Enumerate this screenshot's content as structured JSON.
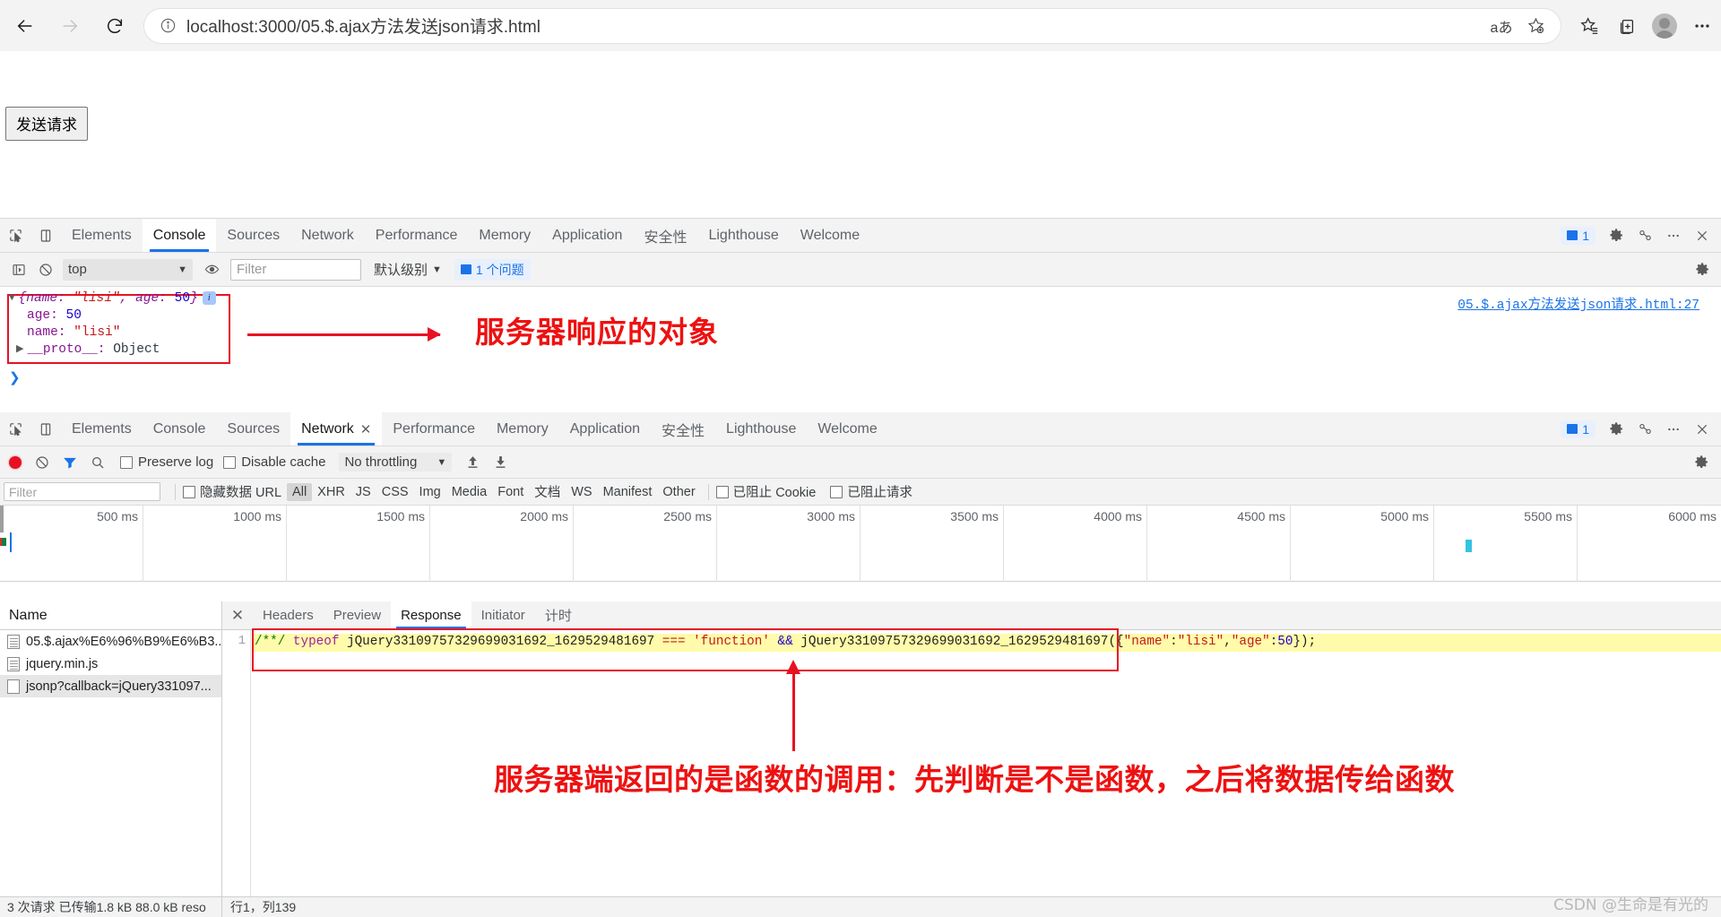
{
  "browser": {
    "back_label": "back-arrow",
    "forward_label": "forward-arrow",
    "reload_label": "reload",
    "url": "localhost:3000/05.$.ajax方法发送json请求.html",
    "read_aloud_label": "aあ",
    "favorite_label": "add-favorite",
    "collections_label": "collections",
    "split_screen_label": "split-screen",
    "profile_label": "profile",
    "settings_label": "..."
  },
  "page": {
    "send_button": "发送请求"
  },
  "console_panel": {
    "tabs": [
      {
        "label": "Elements",
        "active": false
      },
      {
        "label": "Console",
        "active": true
      },
      {
        "label": "Sources",
        "active": false
      },
      {
        "label": "Network",
        "active": false
      },
      {
        "label": "Performance",
        "active": false
      },
      {
        "label": "Memory",
        "active": false
      },
      {
        "label": "Application",
        "active": false
      },
      {
        "label": "安全性",
        "active": false
      },
      {
        "label": "Lighthouse",
        "active": false
      },
      {
        "label": "Welcome",
        "active": false
      }
    ],
    "issues_count": "1",
    "toolbar": {
      "context": "top",
      "filter_placeholder": "Filter",
      "level": "默认级别",
      "issues_pill": "1 个问题"
    },
    "log": {
      "summary_prefix": "{name: ",
      "summary_name": "\"lisi\"",
      "summary_mid": ", age: ",
      "summary_age": "50",
      "summary_suffix": "}",
      "age_key": "age: ",
      "age_value": "50",
      "name_key": "name: ",
      "name_value": "\"lisi\"",
      "proto_key": "__proto__: ",
      "proto_value": "Object"
    },
    "source_link": "05.$.ajax方法发送json请求.html:27",
    "annotation": "服务器响应的对象"
  },
  "network_panel": {
    "tabs": [
      {
        "label": "Elements",
        "active": false,
        "closable": false
      },
      {
        "label": "Console",
        "active": false,
        "closable": false
      },
      {
        "label": "Sources",
        "active": false,
        "closable": false
      },
      {
        "label": "Network",
        "active": true,
        "closable": true
      },
      {
        "label": "Performance",
        "active": false,
        "closable": false
      },
      {
        "label": "Memory",
        "active": false,
        "closable": false
      },
      {
        "label": "Application",
        "active": false,
        "closable": false
      },
      {
        "label": "安全性",
        "active": false,
        "closable": false
      },
      {
        "label": "Lighthouse",
        "active": false,
        "closable": false
      },
      {
        "label": "Welcome",
        "active": false,
        "closable": false
      }
    ],
    "issues_pill": "1",
    "toolbar": {
      "preserve_log": "Preserve log",
      "disable_cache": "Disable cache",
      "throttling": "No throttling"
    },
    "filterbar": {
      "filter_placeholder": "Filter",
      "hide_data_urls": "隐藏数据 URL",
      "types": [
        "All",
        "XHR",
        "JS",
        "CSS",
        "Img",
        "Media",
        "Font",
        "文档",
        "WS",
        "Manifest",
        "Other"
      ],
      "active_type": "All",
      "blocked_cookies": "已阻止 Cookie",
      "blocked_requests": "已阻止请求"
    },
    "timeline_ticks": [
      "500 ms",
      "1000 ms",
      "1500 ms",
      "2000 ms",
      "2500 ms",
      "3000 ms",
      "3500 ms",
      "4000 ms",
      "4500 ms",
      "5000 ms",
      "5500 ms",
      "6000 ms"
    ],
    "name_header": "Name",
    "requests": [
      {
        "name": "05.$.ajax%E6%96%B9%E6%B3...",
        "selected": false,
        "type": "doc"
      },
      {
        "name": "jquery.min.js",
        "selected": false,
        "type": "doc"
      },
      {
        "name": "jsonp?callback=jQuery331097...",
        "selected": true,
        "type": "plain"
      }
    ],
    "detail_tabs": [
      {
        "label": "Headers",
        "active": false
      },
      {
        "label": "Preview",
        "active": false
      },
      {
        "label": "Response",
        "active": true
      },
      {
        "label": "Initiator",
        "active": false
      },
      {
        "label": "计时",
        "active": false
      }
    ],
    "response": {
      "line_number": "1",
      "comment": "/**/",
      "keyword": "typeof",
      "callback1": "jQuery33109757329699031692_1629529481697",
      "op_equals": "===",
      "type_string": "'function'",
      "op_and": "&&",
      "callback2": "jQuery33109757329699031692_1629529481697",
      "args_open": "({",
      "key_name": "\"name\"",
      "colon1": ":",
      "val_name": "\"lisi\"",
      "comma": ",",
      "key_age": "\"age\"",
      "colon2": ":",
      "val_age": "50",
      "args_close": "});"
    },
    "annotation": "服务器端返回的是函数的调用：先判断是不是函数，之后将数据传给函数",
    "status_left": "3 次请求  已传输1.8 kB  88.0 kB reso",
    "status_right": "行1，列139"
  },
  "watermark": "CSDN @生命是有光的",
  "colors": {
    "accent_blue": "#1a73e8",
    "annotation_red": "#ee1111",
    "box_red": "#e81123",
    "highlight_yellow": "#fffbaa"
  }
}
